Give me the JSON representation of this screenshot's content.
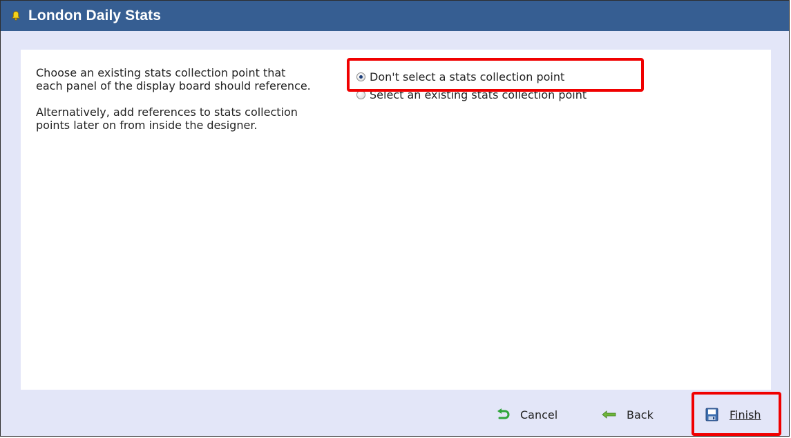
{
  "window": {
    "title": "London Daily Stats",
    "title_icon": "bell-icon"
  },
  "instructions": {
    "paragraph1": "Choose an existing stats collection point that each panel of the display board should reference.",
    "paragraph2": "Alternatively, add references to stats collection points later on from inside the designer."
  },
  "options": [
    {
      "label": "Don't select a stats collection point",
      "selected": true
    },
    {
      "label": "Select an existing stats collection point",
      "selected": false
    }
  ],
  "footer": {
    "cancel_label": "Cancel",
    "cancel_icon": "undo-arrow-icon",
    "back_label": "Back",
    "back_icon": "left-arrow-icon",
    "finish_label": "Finish",
    "finish_icon": "save-disk-icon"
  },
  "colors": {
    "titlebar": "#365e92",
    "dialog_background": "#e3e6f8",
    "highlight": "#f00000",
    "cancel_icon": "#2fa53a",
    "back_icon": "#6fb53c",
    "finish_icon": "#3d6fb0"
  }
}
